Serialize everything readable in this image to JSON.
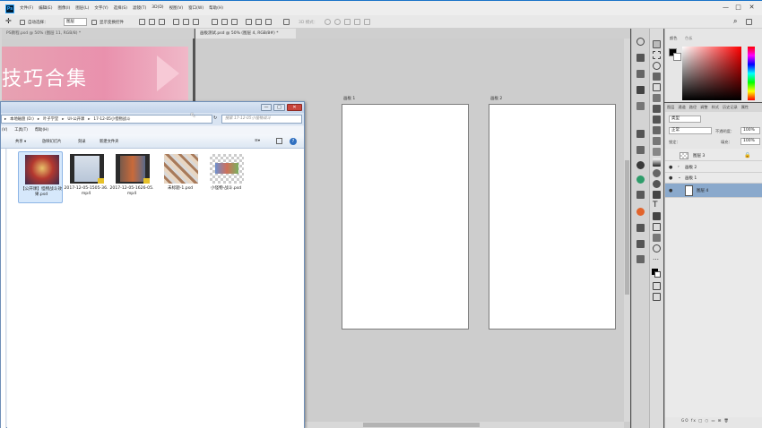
{
  "app": {
    "logo": "Ps",
    "menu": [
      "文件(F)",
      "编辑(E)",
      "图像(I)",
      "图层(L)",
      "文字(Y)",
      "选择(S)",
      "滤镜(T)",
      "3D(D)",
      "视图(V)",
      "窗口(W)",
      "帮助(H)"
    ],
    "window_controls": [
      "—",
      "□",
      "✕"
    ]
  },
  "options_bar": {
    "auto_select_label": "自动选择：",
    "auto_select_value": "图层",
    "show_transform_label": "显示变换控件",
    "mode_3d_label": "3D 模式："
  },
  "documents": [
    {
      "tab": "PS教程.psd @ 50% (图层 11, RGB/8) *",
      "banner_text": "技巧合集"
    },
    {
      "tab": "画板测试.psd @ 50% (图层 4, RGB/8#) *",
      "artboards": [
        "画板 1",
        "画板 2"
      ]
    }
  ],
  "panels": {
    "color_tabs": [
      "颜色",
      "色板"
    ],
    "layers_tabs": [
      "图层",
      "通道",
      "路径",
      "调整",
      "样式",
      "历史记录",
      "属性"
    ],
    "layer_filter": "类型",
    "blend_mode": "正常",
    "opacity_label": "不透明度：",
    "opacity_value": "100%",
    "lock_label": "锁定：",
    "fill_label": "填充：",
    "fill_value": "100%",
    "layers": [
      {
        "name": "图层 3",
        "indent": 0
      },
      {
        "name": "画板 2",
        "indent": 0
      },
      {
        "name": "画板 1",
        "indent": 0
      },
      {
        "name": "图层 4",
        "indent": 1,
        "selected": true
      }
    ],
    "footer_icons": "GO fx □ ○ ▭ ⊞ 🗑"
  },
  "explorer": {
    "address": [
      "本地磁盘 (D:)",
      "叶子学堂",
      "UI-公开课",
      "17-12-05小怪物战斗"
    ],
    "search_placeholder": "搜索 17-12-05小怪物战斗",
    "menu": [
      "(V)",
      "工具(T)",
      "帮助(H)"
    ],
    "toolbar": [
      "共享 ▾",
      "放映幻灯片",
      "刻录",
      "新建文件夹"
    ],
    "files": [
      {
        "name": "【公开课】怪物战斗效果.psd",
        "type": "psd",
        "selected": true
      },
      {
        "name": "2017-12-05-1505-36.mp4",
        "type": "video"
      },
      {
        "name": "2017-12-05-1626-05.mp4",
        "type": "video"
      },
      {
        "name": "未标题-1.psd",
        "type": "psd"
      },
      {
        "name": "小怪物-战斗.psd",
        "type": "psd"
      }
    ]
  },
  "colors": {
    "ps_blue": "#31a8ff",
    "banner_pink": "#e991ad",
    "selection_blue": "#8aa9cc"
  }
}
